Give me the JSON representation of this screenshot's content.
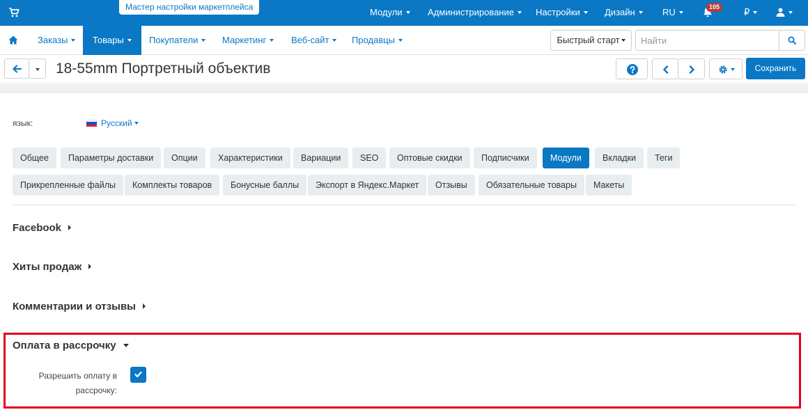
{
  "topbar": {
    "wizard_label": "Мастер настройки маркетплейса",
    "menus": [
      {
        "label": "Модули",
        "has_caret": true
      },
      {
        "label": "Администрирование",
        "has_caret": true
      },
      {
        "label": "Настройки",
        "has_caret": true
      },
      {
        "label": "Дизайн",
        "has_caret": true
      },
      {
        "label": "RU",
        "has_caret": true
      }
    ],
    "notifications_count": "105",
    "currency_label": "₽",
    "icons": [
      "cart-icon",
      "bell-icon",
      "user-icon"
    ]
  },
  "subnav": {
    "items": [
      {
        "label": "Заказы",
        "active": false
      },
      {
        "label": "Товары",
        "active": true
      },
      {
        "label": "Покупатели",
        "active": false
      },
      {
        "label": "Маркетинг",
        "active": false
      },
      {
        "label": "Веб-сайт",
        "active": false
      },
      {
        "label": "Продавцы",
        "active": false
      }
    ],
    "quick_start_label": "Быстрый старт",
    "search_placeholder": "Найти",
    "icons": [
      "home-icon",
      "search-icon"
    ]
  },
  "titlebar": {
    "title": "18-55mm Портретный объектив",
    "save_label": "Сохранить",
    "icons": [
      "arrow-left-icon",
      "chevron-down-icon",
      "help-icon",
      "chevron-left-icon",
      "chevron-right-icon",
      "gear-icon"
    ]
  },
  "content": {
    "language_label": "язык:",
    "language_value": "Русский",
    "tabs_row1": [
      "Общее",
      "Параметры доставки",
      "Опции",
      "Характеристики",
      "Вариации",
      "SEO",
      "Оптовые скидки",
      "Подписчики",
      "Модули",
      "Вкладки",
      "Теги"
    ],
    "tabs_row2": [
      "Прикрепленные файлы",
      "Комплекты товаров",
      "Бонусные баллы",
      "Экспорт в Яндекс.Маркет",
      "Отзывы",
      "Обязательные товары",
      "Макеты"
    ],
    "active_tab": "Модули",
    "sections": [
      {
        "label": "Facebook",
        "expanded": false
      },
      {
        "label": "Хиты продаж",
        "expanded": false
      },
      {
        "label": "Комментарии и отзывы",
        "expanded": false
      },
      {
        "label": "Оплата в рассрочку",
        "expanded": true
      }
    ],
    "installment_field_label": "Разрешить оплату в рассрочку:",
    "installment_checked": true
  },
  "colors": {
    "brand_blue": "#0a78c4",
    "tab_bg": "#e8edf0",
    "highlight_red": "#e3001b",
    "badge_red": "#b83a3a"
  }
}
